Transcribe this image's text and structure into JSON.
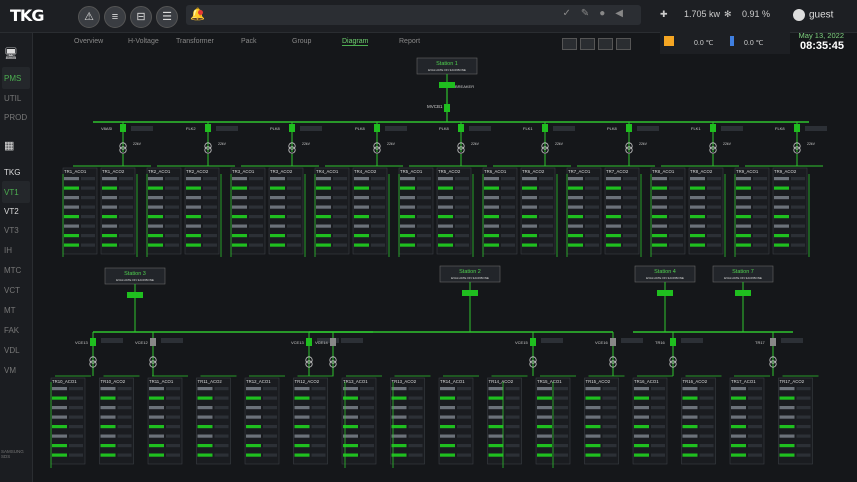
{
  "app": {
    "logo": "TKG"
  },
  "header": {
    "weather": {
      "wind": "1.705 kw",
      "humidity": "0.91 %"
    },
    "user": "guest"
  },
  "weather_panel": {
    "temp1": "0.0 ℃",
    "temp2": "0.0 ℃"
  },
  "datetime": {
    "date": "May 13, 2022",
    "time": "08:35:45"
  },
  "sidebar": {
    "items": [
      "PMS",
      "UTIL",
      "PROD",
      "TKG",
      "VT1",
      "VT2",
      "VT3",
      "IH",
      "MTC",
      "VCT",
      "MT",
      "FAK",
      "VDL",
      "VM"
    ],
    "footer": "SAMSUNG SDS"
  },
  "tabs": [
    "Overview",
    "H-Voltage",
    "Transformer",
    "Pack",
    "Group",
    "Diagram",
    "Report"
  ],
  "active_tab": "Diagram",
  "colors": {
    "accent": "#33dd33",
    "busbar": "#2ec42e",
    "breaker_on": "#1fbf1f",
    "bg": "#15171a"
  },
  "diagram": {
    "stations_top": {
      "name": "Station 1",
      "sub": "EVALUATE ON 3ACKBONE"
    },
    "stations_mid": [
      {
        "name": "Station 3",
        "sub": "EVALUATE ON 3ACKBONE"
      },
      {
        "name": "Station 2",
        "sub": "EVALUATE ON 3ACKBONE"
      },
      {
        "name": "Station 4",
        "sub": "EVALUATE ON 3ACKBONE"
      },
      {
        "name": "Station 7",
        "sub": "EVALUATE ON 3ACKBONE"
      }
    ],
    "top_labels": {
      "breaker": "BREAKER",
      "incomer": "MVCB1"
    },
    "top_feeders": [
      "V8ASI",
      "FLK2",
      "PLK8",
      "PLK8",
      "PLK8",
      "FLK1",
      "PLK8",
      "FLK1",
      "FLK8",
      "FLK8"
    ],
    "top_groups": [
      [
        "TR1_ACO1",
        "TR1_ACO2"
      ],
      [
        "TR2_ACO1",
        "TR2_ACO2"
      ],
      [
        "TR3_ACO1",
        "TR3_ACO2"
      ],
      [
        "TR4_ACO1",
        "TR4_ACO2"
      ],
      [
        "TR5_ACO1",
        "TR5_ACO2"
      ],
      [
        "TR6_ACO1",
        "TR6_ACO2"
      ],
      [
        "TR7_ACO1",
        "TR7_ACO2"
      ],
      [
        "TR8_ACO1",
        "TR8_ACO2"
      ],
      [
        "TR9_ACO1",
        "TR9_ACO2"
      ]
    ],
    "mid_feeders": [
      "VCE13",
      "VCE12",
      "VCE13",
      "VCE14",
      "VCE15",
      "VCE16",
      "TR16",
      "TR17"
    ],
    "bottom_groups": [
      "TR10_ACO1",
      "TR10_ACO2",
      "TR11_ACO1",
      "TR11_ACO2",
      "TR12_ACO1",
      "TR12_ACO2",
      "TR13_ACO1",
      "TR13_ACO2",
      "TR14_ACO1",
      "TR14_ACO2",
      "TR15_ACO1",
      "TR15_ACO2",
      "TR16_ACO1",
      "TR16_ACO2",
      "TR17_ACO1",
      "TR17_ACO2"
    ]
  }
}
